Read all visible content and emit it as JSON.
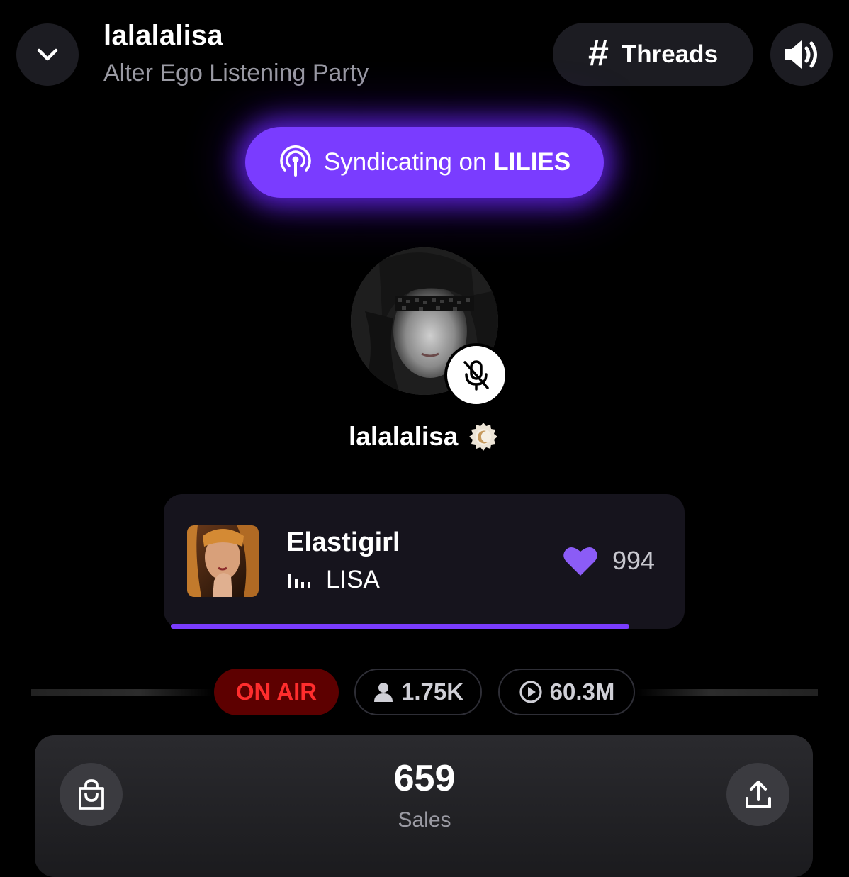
{
  "header": {
    "title": "lalalalisa",
    "subtitle": "Alter Ego Listening Party",
    "threads_label": "Threads",
    "back_icon": "chevron-down-icon",
    "sound_icon": "speaker-icon"
  },
  "syndicate": {
    "prefix": "Syndicating on",
    "channel": "LILIES",
    "icon": "broadcast-icon",
    "color": "#7a3cff"
  },
  "host": {
    "name": "lalalalisa",
    "mic_icon": "mic-muted-icon",
    "badge_icon": "verified-badge-icon"
  },
  "now_playing": {
    "track_title": "Elastigirl",
    "artist": "LISA",
    "likes": "994",
    "progress": 0.905,
    "heart_color": "#8b5cf6"
  },
  "stats": {
    "on_air": "ON AIR",
    "listeners": "1.75K",
    "plays": "60.3M"
  },
  "sales": {
    "count": "659",
    "label": "Sales"
  }
}
